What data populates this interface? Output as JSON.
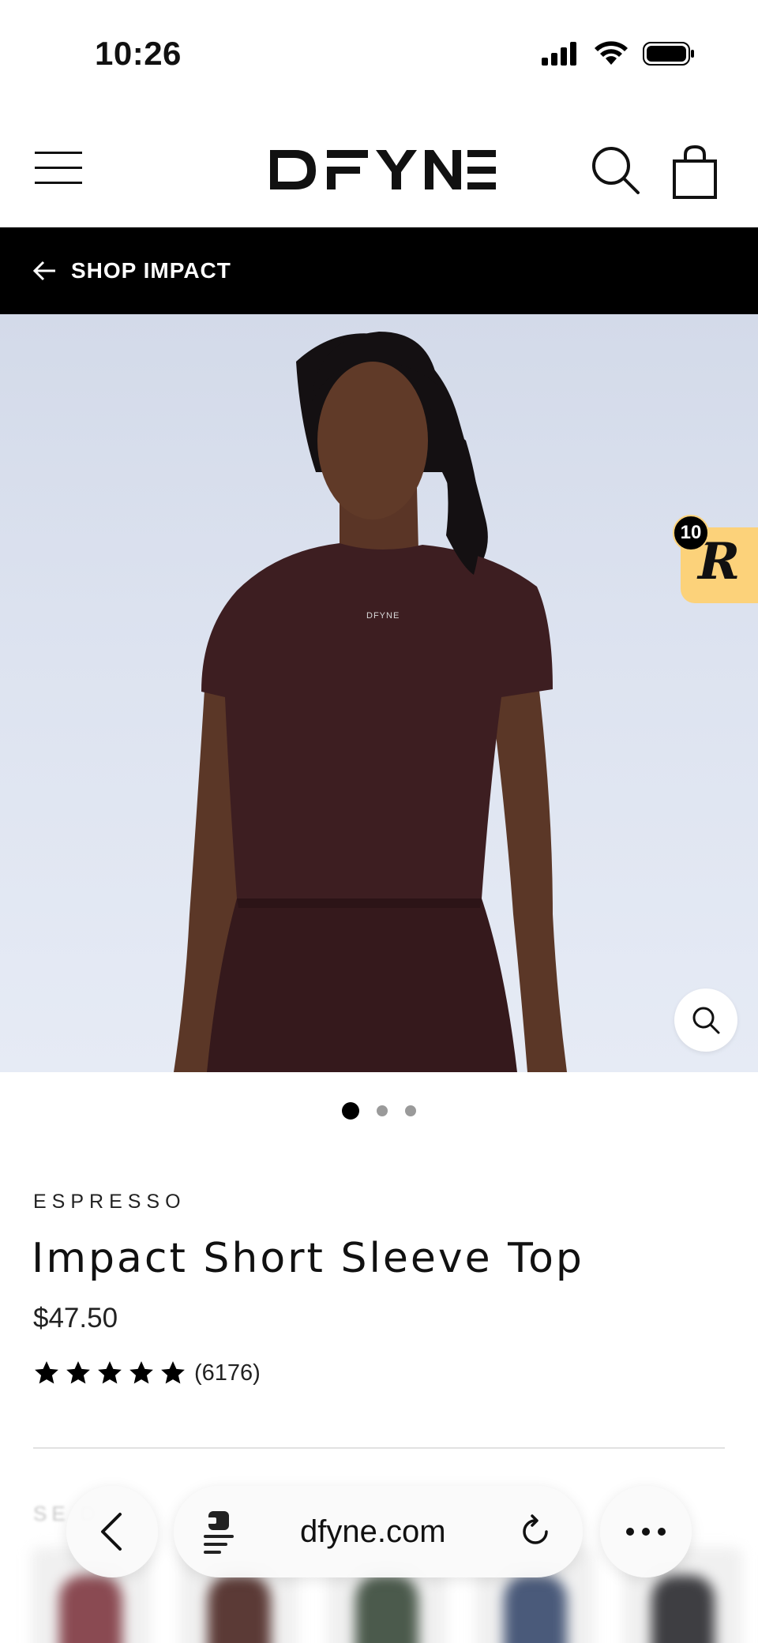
{
  "status_bar": {
    "time": "10:26"
  },
  "header": {
    "logo_text": "DFYNE",
    "icons": [
      "menu-icon",
      "search-icon",
      "bag-icon"
    ]
  },
  "back_bar": {
    "label": "SHOP IMPACT",
    "background": "#000000"
  },
  "hero": {
    "reward_badge_count": "10",
    "reward_letter": "R",
    "reward_color": "#fcd27a",
    "zoom_icon": "magnifier-icon"
  },
  "carousel": {
    "total_slides": 3,
    "active_index": 0
  },
  "product": {
    "color": "ESPRESSO",
    "title": "Impact Short Sleeve Top",
    "price": "$47.50",
    "rating_stars": 5,
    "review_count": "(6176)",
    "section_label_partial": "SE      D"
  },
  "browser": {
    "url": "dfyne.com",
    "icons": [
      "back-chevron-icon",
      "reader-icon",
      "reload-icon",
      "more-icon"
    ]
  },
  "colors": {
    "accent": "#000000",
    "garment": "#3e1f22",
    "hero_bg": "#dbe1ee"
  }
}
